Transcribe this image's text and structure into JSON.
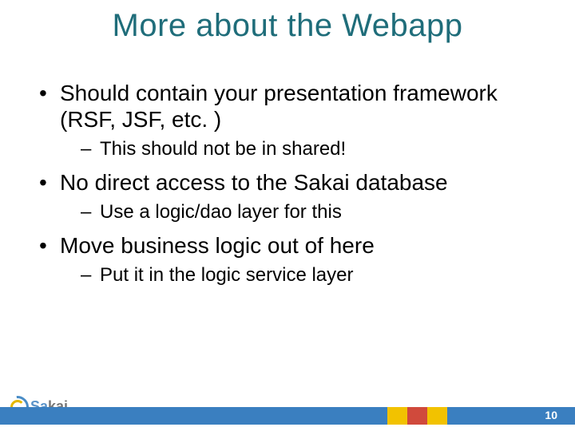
{
  "title": "More about the Webapp",
  "bullets": [
    {
      "text": "Should contain your presentation framework (RSF, JSF, etc. )",
      "sub": [
        "This should not be in shared!"
      ]
    },
    {
      "text": "No direct access to the Sakai database",
      "sub": [
        "Use a logic/dao layer for this"
      ]
    },
    {
      "text": "Move business logic out of here",
      "sub": [
        "Put it in the logic service layer"
      ]
    }
  ],
  "page_number": "10",
  "logo": {
    "part1": "Sa",
    "part2": "kai"
  }
}
